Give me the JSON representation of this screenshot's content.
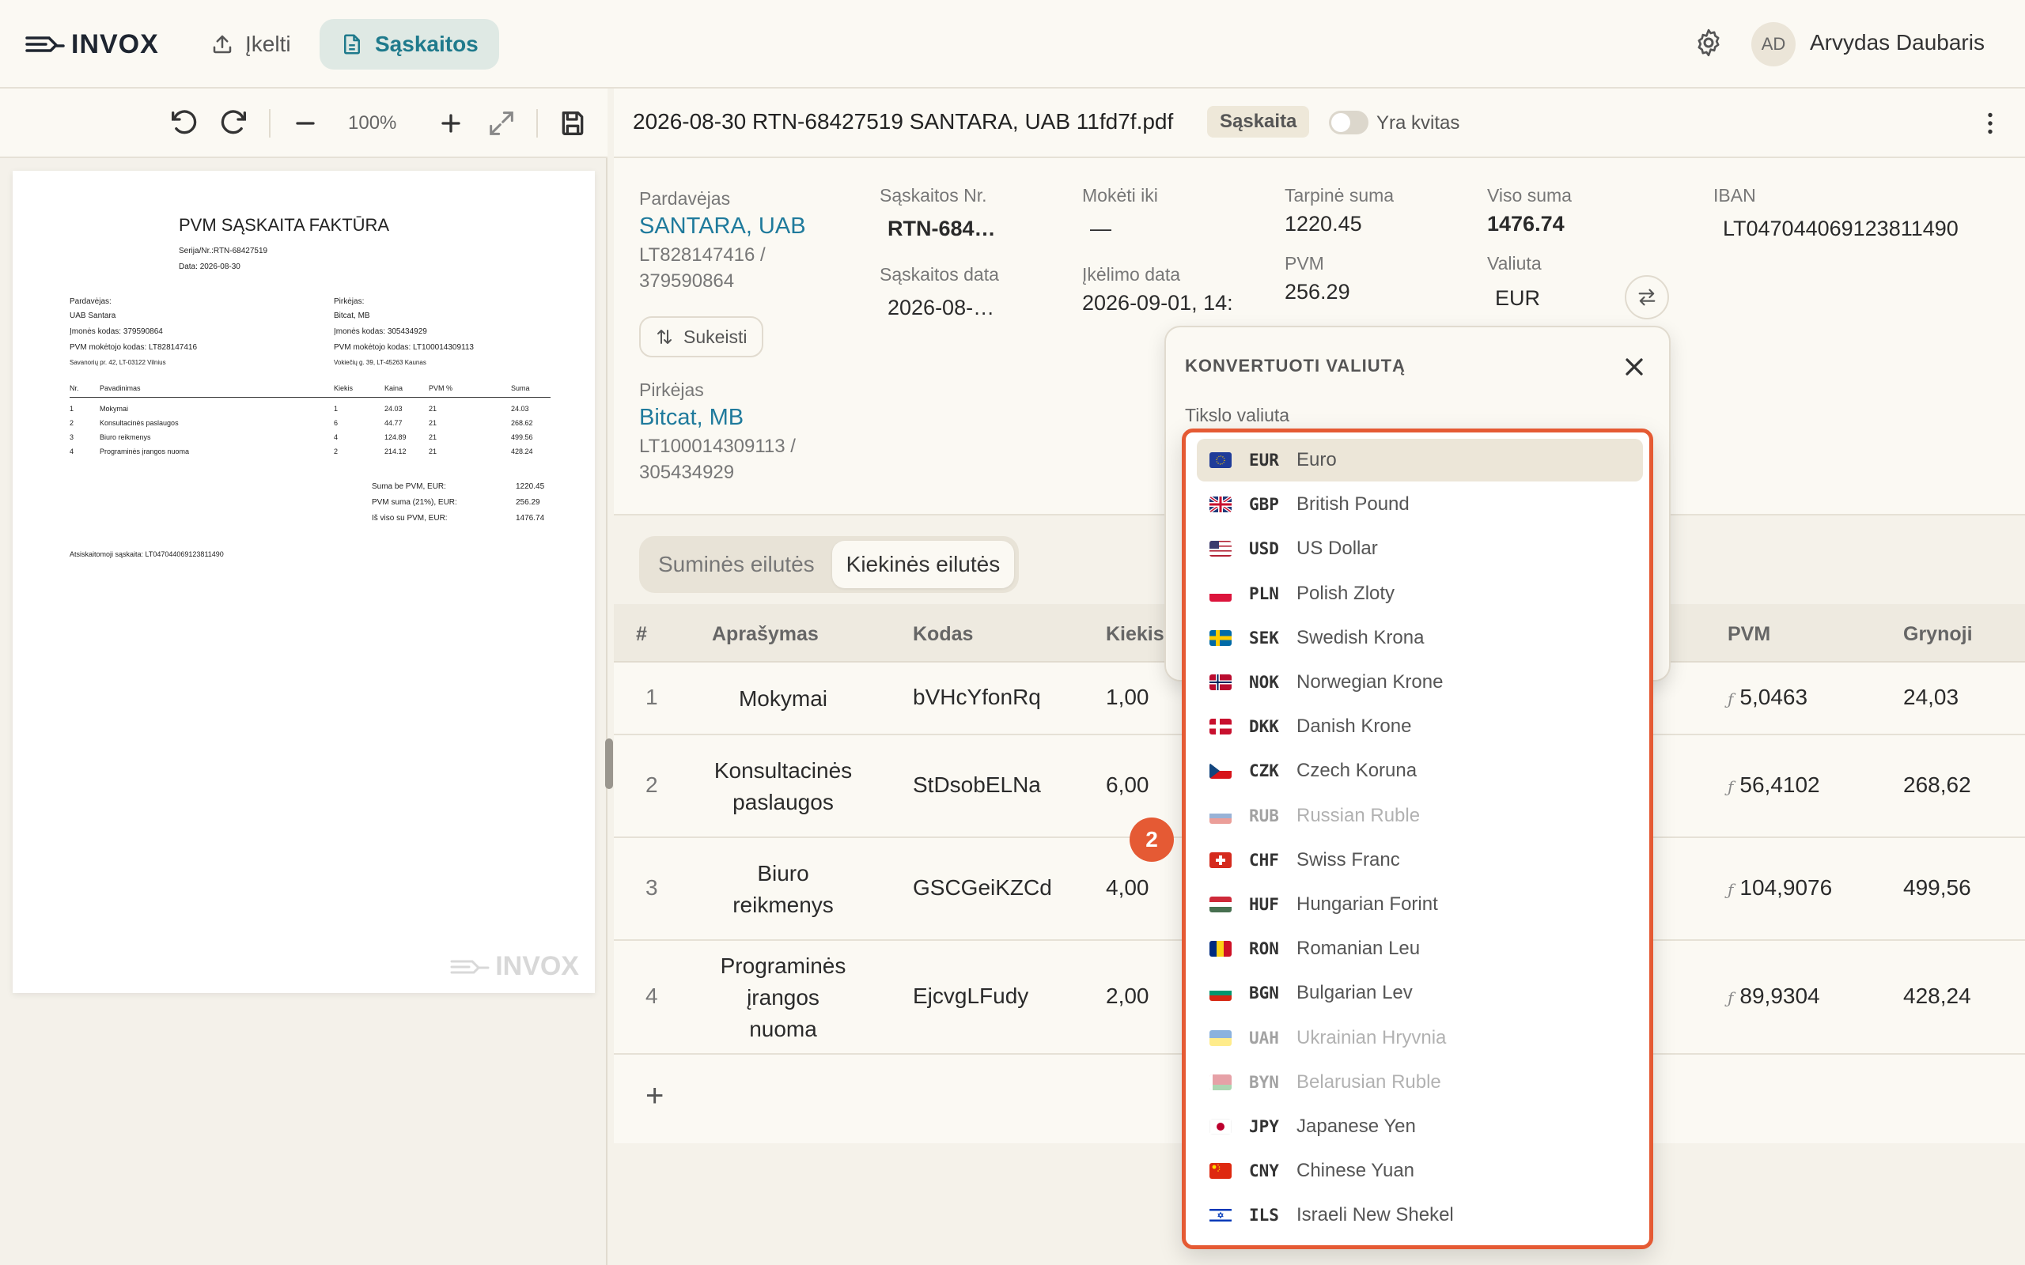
{
  "app": {
    "name": "INVOX"
  },
  "nav": {
    "upload": "Įkelti",
    "invoices": "Sąskaitos"
  },
  "user": {
    "initials": "AD",
    "name": "Arvydas Daubaris"
  },
  "pdf_toolbar": {
    "zoom": "100%"
  },
  "pdf": {
    "title": "PVM SĄSKAITA FAKTŪRA",
    "series_label": "Serija/Nr.:",
    "series": "RTN-68427519",
    "date_label": "Data:",
    "date": "2026-08-30",
    "seller_label": "Pardavėjas:",
    "seller_name": "UAB Santara",
    "seller_code": "Įmonės kodas: 379590864",
    "seller_vat": "PVM mokėtojo kodas: LT828147416",
    "seller_address": "Savanorių pr. 42, LT-03122 Vilnius",
    "buyer_label": "Pirkėjas:",
    "buyer_name": "Bitcat, MB",
    "buyer_code": "Įmonės kodas: 305434929",
    "buyer_vat": "PVM mokėtojo kodas: LT100014309113",
    "buyer_address": "Vokiečių g. 39, LT-45263 Kaunas",
    "columns": [
      "Nr.",
      "Pavadinimas",
      "Kiekis",
      "Kaina",
      "PVM %",
      "Suma"
    ],
    "rows": [
      [
        "1",
        "Mokymai",
        "1",
        "24.03",
        "21",
        "24.03"
      ],
      [
        "2",
        "Konsultacinės paslaugos",
        "6",
        "44.77",
        "21",
        "268.62"
      ],
      [
        "3",
        "Biuro reikmenys",
        "4",
        "124.89",
        "21",
        "499.56"
      ],
      [
        "4",
        "Programinės įrangos nuoma",
        "2",
        "214.12",
        "21",
        "428.24"
      ]
    ],
    "totals": [
      [
        "Suma be PVM, EUR:",
        "1220.45"
      ],
      [
        "PVM suma (21%), EUR:",
        "256.29"
      ],
      [
        "Iš viso su PVM, EUR:",
        "1476.74"
      ]
    ],
    "account": "Atsiskaitomoji sąskaita: LT047044069123811490",
    "watermark": "INVOX"
  },
  "doc": {
    "title": "2026-08-30 RTN-68427519 SANTARA, UAB 11fd7f.pdf",
    "badge": "Sąskaita",
    "toggle_label": "Yra kvitas"
  },
  "info": {
    "seller_label": "Pardavėjas",
    "seller_name": "SANTARA, UAB",
    "seller_codes": "LT828147416 /\n379590864",
    "swap": "Sukeisti",
    "buyer_label": "Pirkėjas",
    "buyer_name": "Bitcat, MB",
    "buyer_codes": "LT100014309113 /\n305434929",
    "invoice_no_label": "Sąskaitos Nr.",
    "invoice_no": "RTN-684…",
    "invoice_date_label": "Sąskaitos data",
    "invoice_date": "2026-08-…",
    "due_label": "Mokėti iki",
    "due": "—",
    "upload_date_label": "Įkėlimo data",
    "upload_date": "2026-09-01, 14:",
    "subtotal_label": "Tarpinė suma",
    "subtotal": "1220.45",
    "vat_label": "PVM",
    "vat": "256.29",
    "total_label": "Viso suma",
    "total": "1476.74",
    "currency_label": "Valiuta",
    "currency": "EUR",
    "iban_label": "IBAN",
    "iban": "LT047044069123811490"
  },
  "tabs": {
    "sum": "Suminės eilutės",
    "qty": "Kiekinės eilutės"
  },
  "table": {
    "headers": {
      "num": "#",
      "desc": "Aprašymas",
      "code": "Kodas",
      "qty": "Kiekis",
      "vat": "PVM",
      "net": "Grynoji"
    },
    "rows": [
      {
        "num": "1",
        "desc": "Mokymai",
        "code": "bVHcYfonRq",
        "qty": "1,00",
        "vat": "5,0463",
        "net": "24,03"
      },
      {
        "num": "2",
        "desc": "Konsultacinės paslaugos",
        "code": "StDsobELNa",
        "qty": "6,00",
        "vat": "56,4102",
        "net": "268,62"
      },
      {
        "num": "3",
        "desc": "Biuro reikmenys",
        "code": "GSCGeiKZCd",
        "qty": "4,00",
        "vat": "104,9076",
        "net": "499,56"
      },
      {
        "num": "4",
        "desc": "Programinės įrangos nuoma",
        "code": "EjcvgLFudy",
        "qty": "2,00",
        "vat": "89,9304",
        "net": "428,24"
      }
    ],
    "add": "+"
  },
  "popover": {
    "title": "KONVERTUOTI VALIUTĄ",
    "target_label": "Tikslo valiuta"
  },
  "marker": "2",
  "currencies": [
    {
      "code": "EUR",
      "name": "Euro",
      "flag": "eu",
      "selected": true,
      "disabled": false
    },
    {
      "code": "GBP",
      "name": "British Pound",
      "flag": "gb",
      "selected": false,
      "disabled": false
    },
    {
      "code": "USD",
      "name": "US Dollar",
      "flag": "us",
      "selected": false,
      "disabled": false
    },
    {
      "code": "PLN",
      "name": "Polish Zloty",
      "flag": "pl",
      "selected": false,
      "disabled": false
    },
    {
      "code": "SEK",
      "name": "Swedish Krona",
      "flag": "se",
      "selected": false,
      "disabled": false
    },
    {
      "code": "NOK",
      "name": "Norwegian Krone",
      "flag": "no",
      "selected": false,
      "disabled": false
    },
    {
      "code": "DKK",
      "name": "Danish Krone",
      "flag": "dk",
      "selected": false,
      "disabled": false
    },
    {
      "code": "CZK",
      "name": "Czech Koruna",
      "flag": "cz",
      "selected": false,
      "disabled": false
    },
    {
      "code": "RUB",
      "name": "Russian Ruble",
      "flag": "ru",
      "selected": false,
      "disabled": true
    },
    {
      "code": "CHF",
      "name": "Swiss Franc",
      "flag": "ch",
      "selected": false,
      "disabled": false
    },
    {
      "code": "HUF",
      "name": "Hungarian Forint",
      "flag": "hu",
      "selected": false,
      "disabled": false
    },
    {
      "code": "RON",
      "name": "Romanian Leu",
      "flag": "ro",
      "selected": false,
      "disabled": false
    },
    {
      "code": "BGN",
      "name": "Bulgarian Lev",
      "flag": "bg",
      "selected": false,
      "disabled": false
    },
    {
      "code": "UAH",
      "name": "Ukrainian Hryvnia",
      "flag": "ua",
      "selected": false,
      "disabled": true
    },
    {
      "code": "BYN",
      "name": "Belarusian Ruble",
      "flag": "by",
      "selected": false,
      "disabled": true
    },
    {
      "code": "JPY",
      "name": "Japanese Yen",
      "flag": "jp",
      "selected": false,
      "disabled": false
    },
    {
      "code": "CNY",
      "name": "Chinese Yuan",
      "flag": "cn",
      "selected": false,
      "disabled": false
    },
    {
      "code": "ILS",
      "name": "Israeli New Shekel",
      "flag": "il",
      "selected": false,
      "disabled": false
    }
  ]
}
